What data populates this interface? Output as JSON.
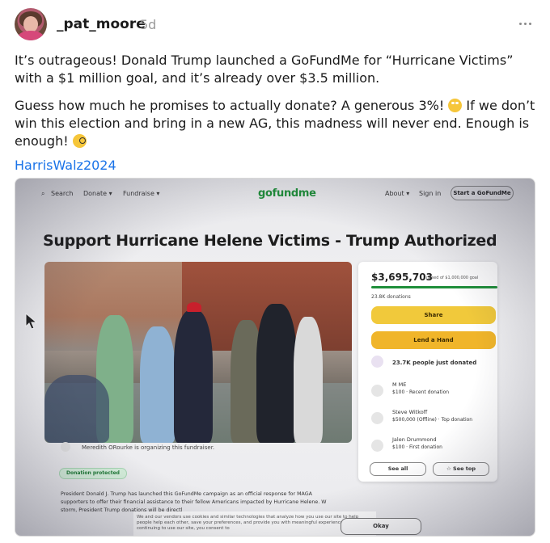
{
  "post": {
    "username": "_pat_moore",
    "age": "5d",
    "paragraph1": "It’s outrageous! Donald Trump launched a GoFundMe for “Hurricane Victims” with a $1 million goal, and it’s already over $3.5 million.",
    "paragraph2_a": "Guess how much he promises to actually donate? A generous 3%! ",
    "paragraph2_b": " If we don’t win this election and bring in a new AG, this madness will never end. Enough is enough! ",
    "hashtag": "HarrisWalz2024"
  },
  "gofundme": {
    "nav": {
      "search": "Search",
      "donate": "Donate ▾",
      "fundraise": "Fundraise ▾",
      "logo": "gofundme",
      "about": "About ▾",
      "signin": "Sign in",
      "start": "Start a GoFundMe"
    },
    "title": "Support Hurricane Helene Victims - Trump Authorized",
    "amount": "$3,695,703",
    "goal_text": "raised of $1,000,000 goal",
    "progress_fraction": 1.0,
    "donations_count": "23.8K donations",
    "share_label": "Share",
    "lend_label": "Lend a Hand",
    "people_donated": "23.7K people just donated",
    "donors": [
      {
        "name": "M ME",
        "amount": "$100 · Recent donation"
      },
      {
        "name": "Steve Witkoff",
        "amount": "$500,000 (Offline) · Top donation"
      },
      {
        "name": "Jalen Drummond",
        "amount": "$100 · First donation"
      }
    ],
    "see_all": "See all",
    "see_top": "☆ See top",
    "organizer": "Meredith ORourke is organizing this fundraiser.",
    "protected": "Donation protected",
    "description": "President Donald J. Trump has launched this GoFundMe campaign as an official response for MAGA supporters to offer their financial assistance to their fellow Americans impacted by Hurricane Helene. W storm, President Trump donations will be directl",
    "cookie": "We and our vendors use cookies and similar technologies that analyze how you use our site to help people help each other, save your preferences, and provide you with meaningful experiences. By continuing to use our site, you consent to",
    "okay": "Okay"
  },
  "colors": {
    "link": "#1a73e8",
    "gfm_green": "#1f8f3a",
    "share_yellow": "#f1c93b",
    "lend_orange": "#f0b52a"
  },
  "icons": [
    "more-icon",
    "rolling-eyes-emoji",
    "monocle-emoji",
    "search-icon",
    "mouse-cursor-icon"
  ]
}
